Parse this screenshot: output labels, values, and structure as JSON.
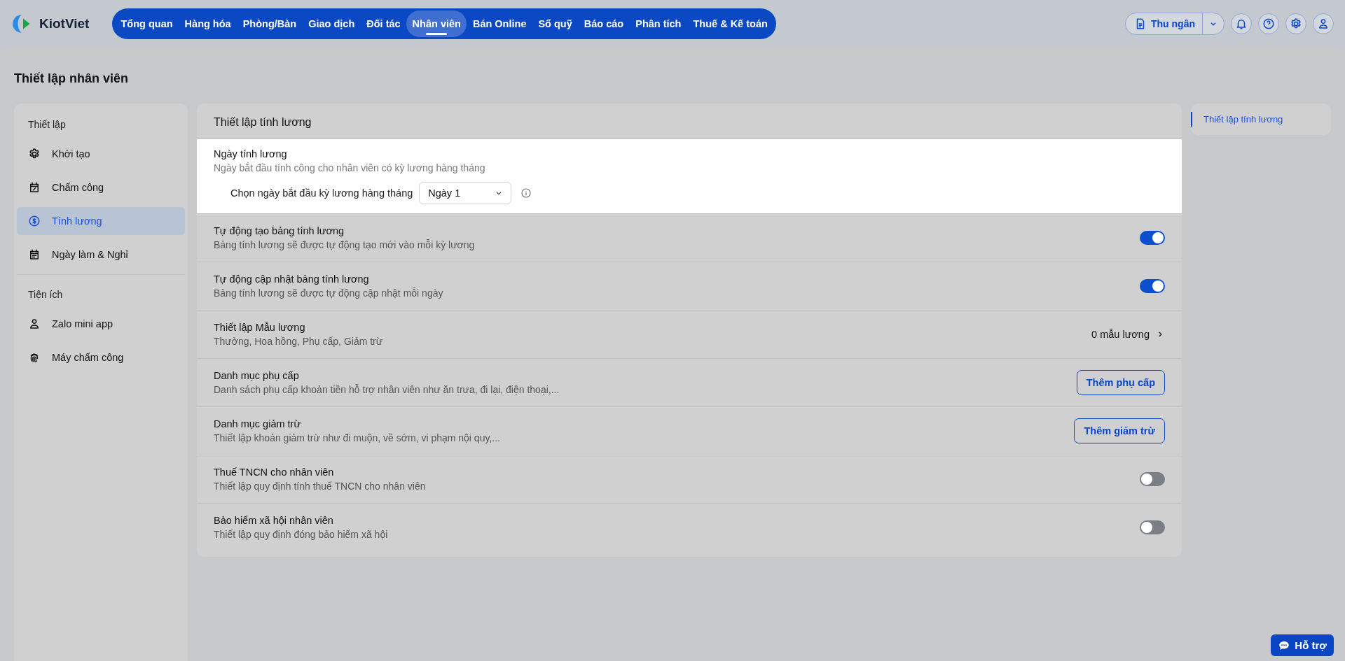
{
  "app": {
    "logo": "KiotViet"
  },
  "nav": [
    {
      "label": "Tổng quan",
      "selected": false
    },
    {
      "label": "Hàng hóa",
      "selected": false
    },
    {
      "label": "Phòng/Bàn",
      "selected": false
    },
    {
      "label": "Giao dịch",
      "selected": false
    },
    {
      "label": "Đối tác",
      "selected": false
    },
    {
      "label": "Nhân viên",
      "selected": true
    },
    {
      "label": "Bán Online",
      "selected": false
    },
    {
      "label": "Sổ quỹ",
      "selected": false
    },
    {
      "label": "Báo cáo",
      "selected": false
    },
    {
      "label": "Phân tích",
      "selected": false
    },
    {
      "label": "Thuế & Kế toán",
      "selected": false
    }
  ],
  "header_actions": {
    "role_button": "Thu ngân"
  },
  "page": {
    "title": "Thiết lập nhân viên"
  },
  "sidebar": {
    "sections": [
      {
        "heading": "Thiết lập",
        "items": [
          {
            "label": "Khởi tạo",
            "selected": false
          },
          {
            "label": "Chấm công",
            "selected": false
          },
          {
            "label": "Tính lương",
            "selected": true
          },
          {
            "label": "Ngày làm & Nghỉ",
            "selected": false
          }
        ]
      },
      {
        "heading": "Tiện ích",
        "items": [
          {
            "label": "Zalo mini app",
            "selected": false
          },
          {
            "label": "Máy chấm công",
            "selected": false
          }
        ]
      }
    ]
  },
  "content": {
    "title": "Thiết lập tính lương",
    "rows": [
      {
        "kind": "select",
        "highlighted": true,
        "title": "Ngày tính lương",
        "description": "Ngày bắt đầu tính công cho nhân viên có kỳ lương hàng tháng",
        "select_label": "Chọn ngày bắt đầu kỳ lương hàng tháng",
        "select_value": "Ngày 1"
      },
      {
        "kind": "toggle",
        "highlighted": false,
        "title": "Tự động tạo bảng tính lương",
        "description": "Bảng tính lương sẽ được tự động tạo mới vào mỗi kỳ lương",
        "on": true
      },
      {
        "kind": "toggle",
        "highlighted": false,
        "title": "Tự động cập nhật bảng tính lương",
        "description": "Bảng tính lương sẽ được tự động cập nhật mỗi ngày",
        "on": true
      },
      {
        "kind": "link",
        "highlighted": false,
        "title": "Thiết lập Mẫu lương",
        "description": "Thưởng, Hoa hồng, Phụ cấp, Giảm trừ",
        "value": "0 mẫu lương"
      },
      {
        "kind": "button",
        "highlighted": false,
        "title": "Danh mục phụ cấp",
        "description": "Danh sách phụ cấp khoản tiền hỗ trợ nhân viên như ăn trưa, đi lại, điện thoại,...",
        "button": "Thêm phụ cấp"
      },
      {
        "kind": "button",
        "highlighted": false,
        "title": "Danh mục giảm trừ",
        "description": "Thiết lập khoản giảm trừ như đi muộn, về sớm, vi phạm nội quy,...",
        "button": "Thêm giảm trừ"
      },
      {
        "kind": "toggle",
        "highlighted": false,
        "title": "Thuế TNCN cho nhân viên",
        "description": "Thiết lập quy định tính thuế TNCN cho nhân viên",
        "on": false
      },
      {
        "kind": "toggle",
        "highlighted": false,
        "title": "Bảo hiểm xã hội nhân viên",
        "description": "Thiết lập quy định đóng bảo hiểm xã hội",
        "on": false
      }
    ]
  },
  "toc": [
    {
      "label": "Thiết lập tính lương",
      "selected": true
    }
  ],
  "support_button": "Hỗ trợ"
}
